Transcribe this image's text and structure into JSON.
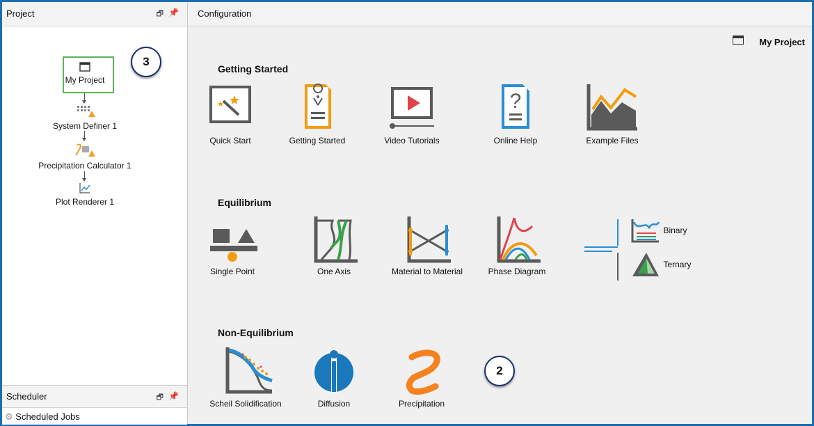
{
  "project_panel": {
    "title": "Project",
    "nodes": [
      {
        "label": "My Project",
        "icon": "window-icon"
      },
      {
        "label": "System Definer 1",
        "icon": "system-definer-icon"
      },
      {
        "label": "Precipitation Calculator 1",
        "icon": "precipitation-calculator-icon"
      },
      {
        "label": "Plot Renderer 1",
        "icon": "plot-renderer-icon"
      }
    ],
    "badge": "3"
  },
  "scheduler_panel": {
    "title": "Scheduler",
    "item": "Scheduled Jobs"
  },
  "configuration": {
    "title": "Configuration",
    "project_name": "My Project",
    "badge": "2",
    "sections": {
      "getting_started": {
        "title": "Getting Started",
        "items": [
          "Quick Start",
          "Getting Started",
          "Video Tutorials",
          "Online Help",
          "Example Files"
        ]
      },
      "equilibrium": {
        "title": "Equilibrium",
        "items": [
          "Single Point",
          "One Axis",
          "Material to Material",
          "Phase Diagram",
          "Binary",
          "Ternary"
        ]
      },
      "non_equilibrium": {
        "title": "Non-Equilibrium",
        "items": [
          "Scheil Solidification",
          "Diffusion",
          "Precipitation"
        ]
      }
    }
  },
  "colors": {
    "frame": "#1b6fb3",
    "orange": "#f39c12",
    "blue": "#2a8ed6",
    "red": "#e0434c",
    "green": "#3aa14a",
    "gray": "#5a5a5a"
  }
}
